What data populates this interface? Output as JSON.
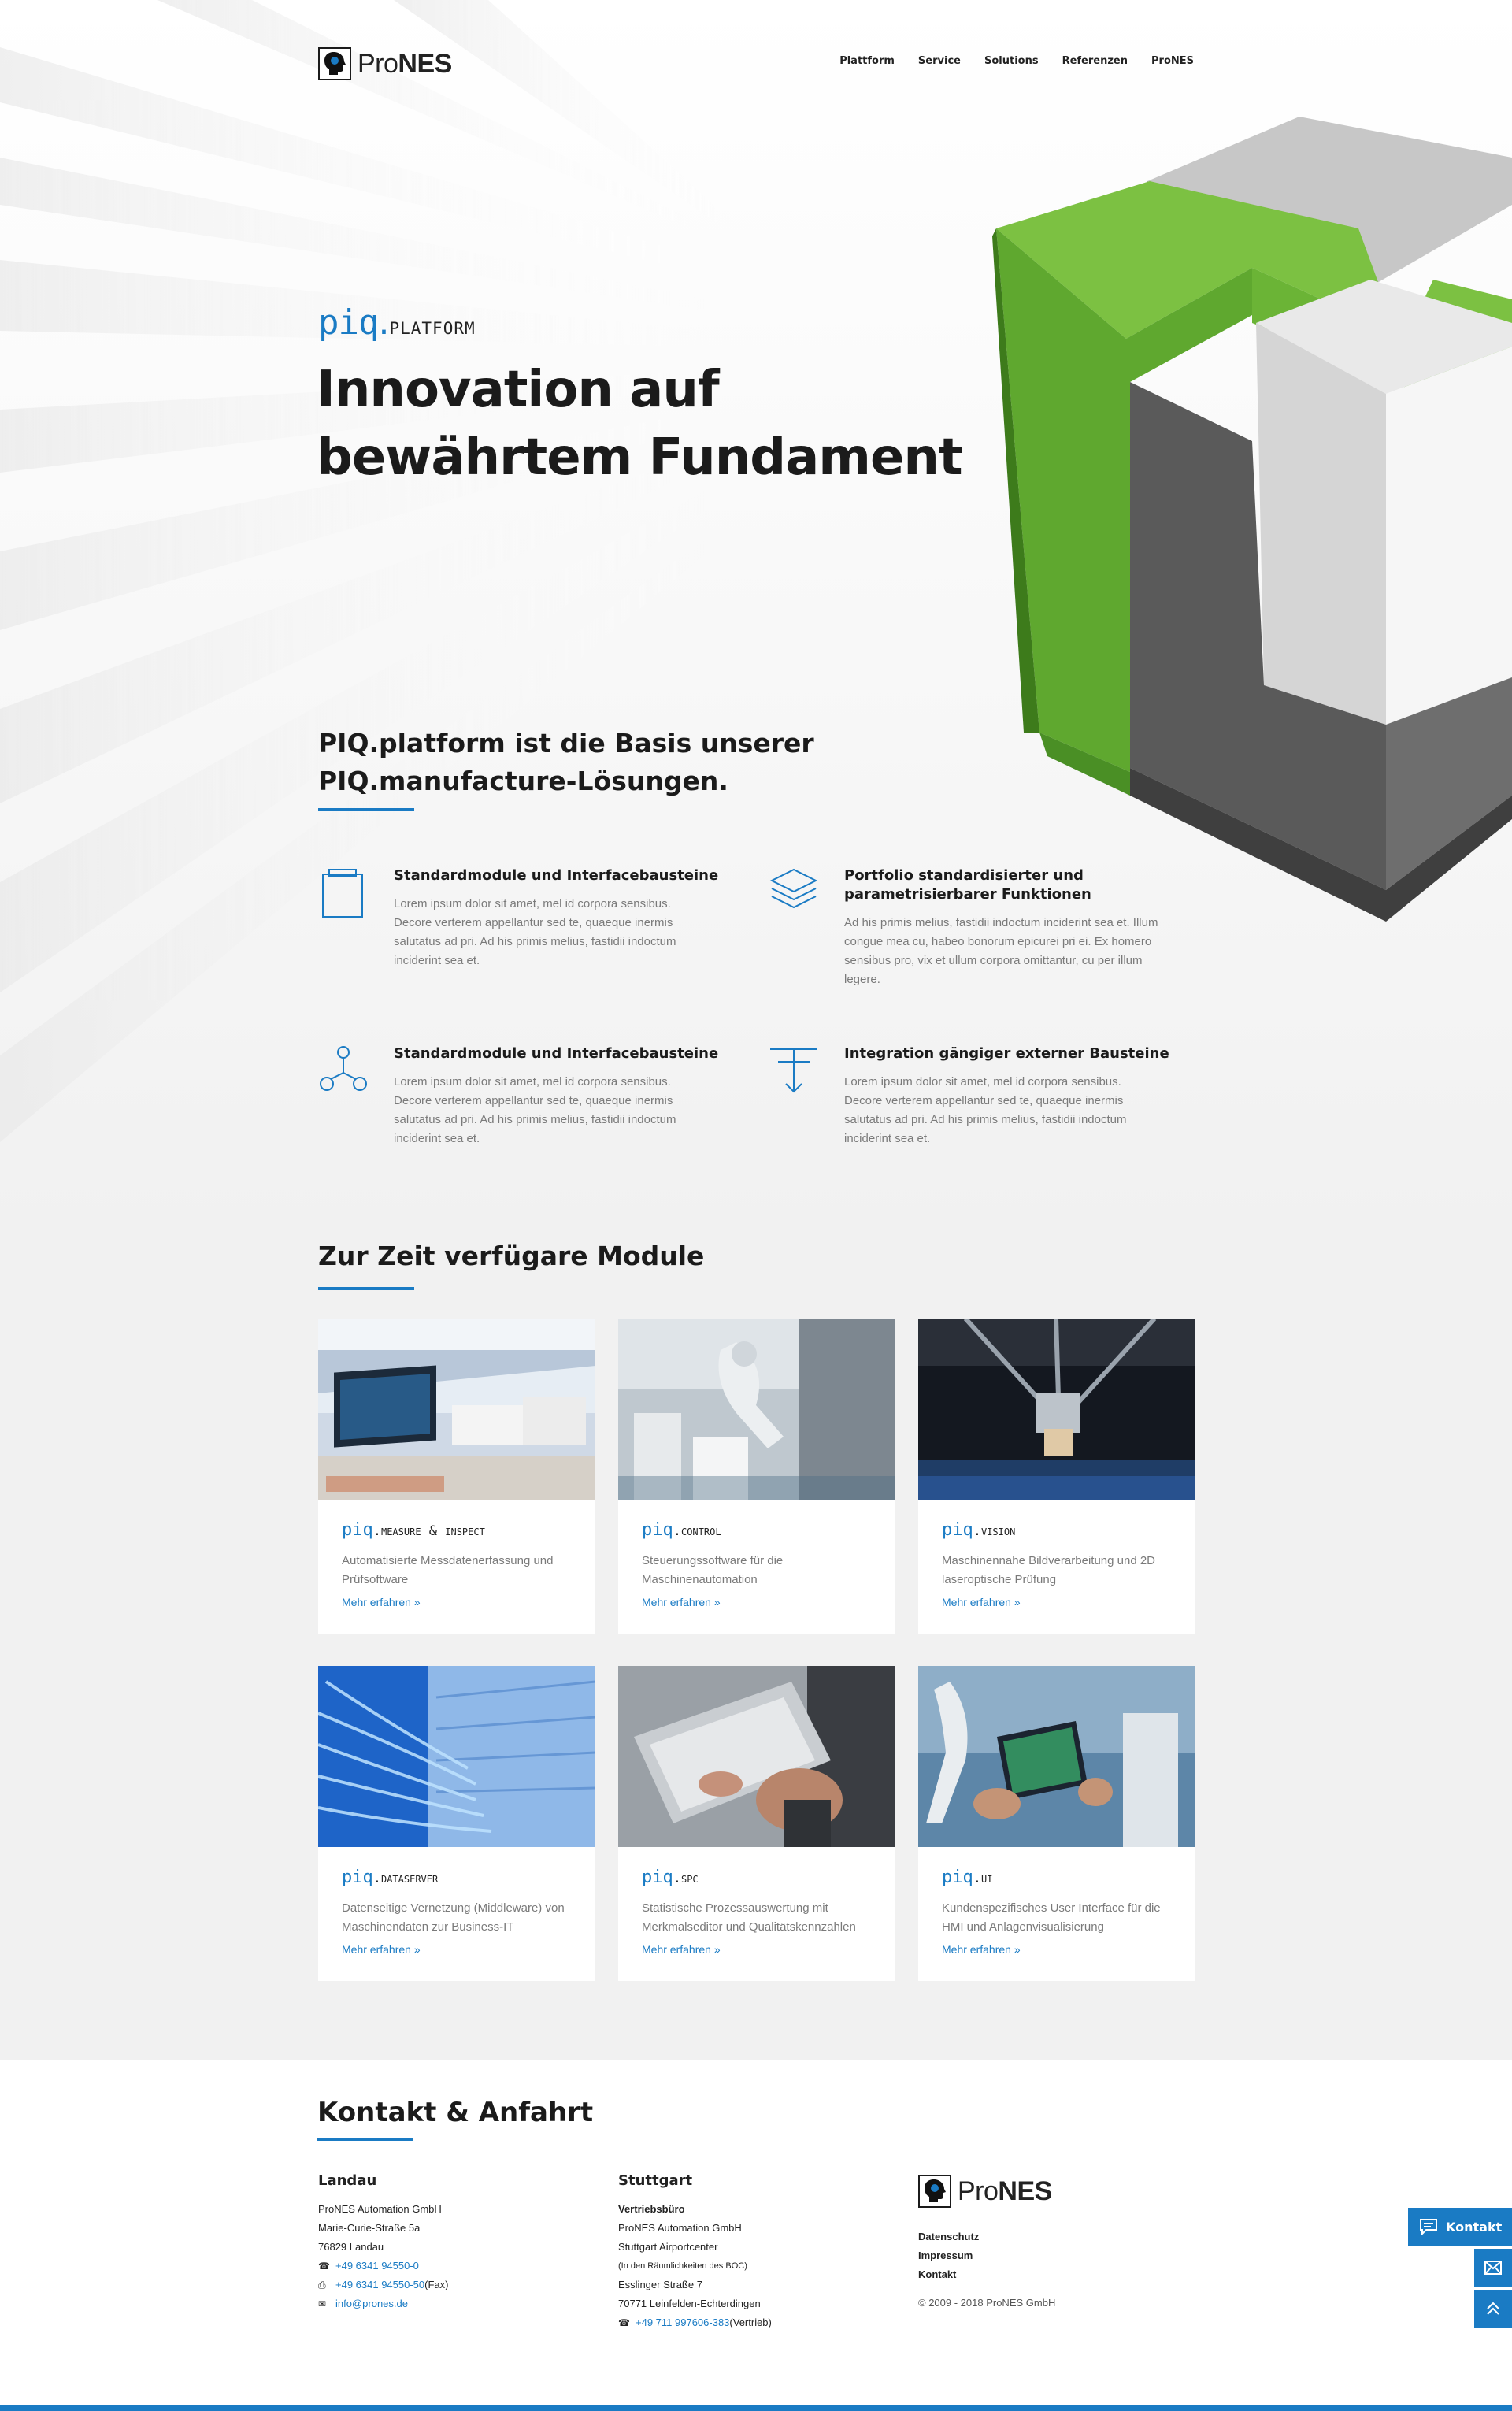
{
  "brand": {
    "pro": "Pro",
    "nes": "NES"
  },
  "nav": [
    "Plattform",
    "Service",
    "Solutions",
    "Referenzen",
    "ProNES"
  ],
  "hero": {
    "piq": "piq",
    "dot": ".",
    "platform": "platform",
    "title_line1": "Innovation auf",
    "title_line2": "bewährtem Fundament"
  },
  "intro": {
    "line1": "PIQ.platform ist die Basis unserer",
    "line2": "PIQ.manufacture-Lösungen."
  },
  "features": [
    {
      "icon": "module-box-icon",
      "title": "Standardmodule und Interfacebausteine",
      "text": "Lorem ipsum dolor sit amet, mel id corpora sensibus. Decore verterem appellantur sed te, quaeque inermis salutatus ad pri. Ad his primis melius, fastidii indoctum inciderint sea et."
    },
    {
      "icon": "layers-icon",
      "title": "Portfolio standardisierter und parametrisierbarer Funktionen",
      "text": "Ad his primis melius, fastidii indoctum inciderint sea et. Illum congue mea cu, habeo bonorum epicurei pri ei. Ex homero sensibus pro, vix et ullum corpora omittantur, cu per illum legere."
    },
    {
      "icon": "network-icon",
      "title": "Standardmodule und Interfacebausteine",
      "text": "Lorem ipsum dolor sit amet, mel id corpora sensibus. Decore verterem appellantur sed te, quaeque inermis salutatus ad pri. Ad his primis melius, fastidii indoctum inciderint sea et."
    },
    {
      "icon": "integration-arrow-icon",
      "title": "Integration gängiger externer Bausteine",
      "text": "Lorem ipsum dolor sit amet, mel id corpora sensibus. Decore verterem appellantur sed te, quaeque inermis salutatus ad pri. Ad his primis melius, fastidii indoctum inciderint sea et."
    }
  ],
  "modules": {
    "title": "Zur Zeit verfügare Module",
    "more": "Mehr erfahren »",
    "items": [
      {
        "p": "piq",
        "name": ".measure & inspect",
        "desc": "Automatisierte Messdatenerfassung und Prüfsoftware"
      },
      {
        "p": "piq",
        "name": ".control",
        "desc": "Steuerungssoftware für die Maschinenautomation"
      },
      {
        "p": "piq",
        "name": ".vision",
        "desc": "Maschinennahe Bildverarbeitung und 2D laseroptische Prüfung"
      },
      {
        "p": "piq",
        "name": ".dataserver",
        "desc": "Datenseitige Vernetzung (Middleware) von Maschinendaten zur Business-IT"
      },
      {
        "p": "piq",
        "name": ".spc",
        "desc": "Statistische Prozessauswertung mit Merkmalseditor und Qualitätskennzahlen"
      },
      {
        "p": "piq",
        "name": ".ui",
        "desc": "Kundenspezifisches User Interface für die HMI und Anlagenvisualisierung"
      }
    ]
  },
  "footer": {
    "title": "Kontakt & Anfahrt",
    "landau": {
      "heading": "Landau",
      "company": "ProNES Automation GmbH",
      "street": "Marie-Curie-Straße 5a",
      "city": "76829 Landau",
      "phone": "+49 6341 94550-0",
      "fax": "+49 6341 94550-50",
      "fax_suffix": " (Fax)",
      "email": "info@prones.de"
    },
    "stuttgart": {
      "heading": "Stuttgart",
      "sub": "Vertriebsbüro",
      "company": "ProNES Automation GmbH",
      "place": "Stuttgart Airportcenter",
      "note": "(In den Räumlichkeiten des BOC)",
      "street": "Esslinger Straße 7",
      "city": "70771 Leinfelden-Echterdingen",
      "phone": "+49 711 997606-383",
      "phone_suffix": " (Vertrieb)"
    },
    "links": [
      "Datenschutz",
      "Impressum",
      "Kontakt"
    ],
    "copyright": "© 2009 - 2018 ProNES GmbH"
  },
  "side": {
    "kontakt": "Kontakt"
  },
  "colors": {
    "accent": "#1a7bc4",
    "green": "#7cc142",
    "text": "#1b1b1b",
    "muted": "#7a7a7a"
  }
}
